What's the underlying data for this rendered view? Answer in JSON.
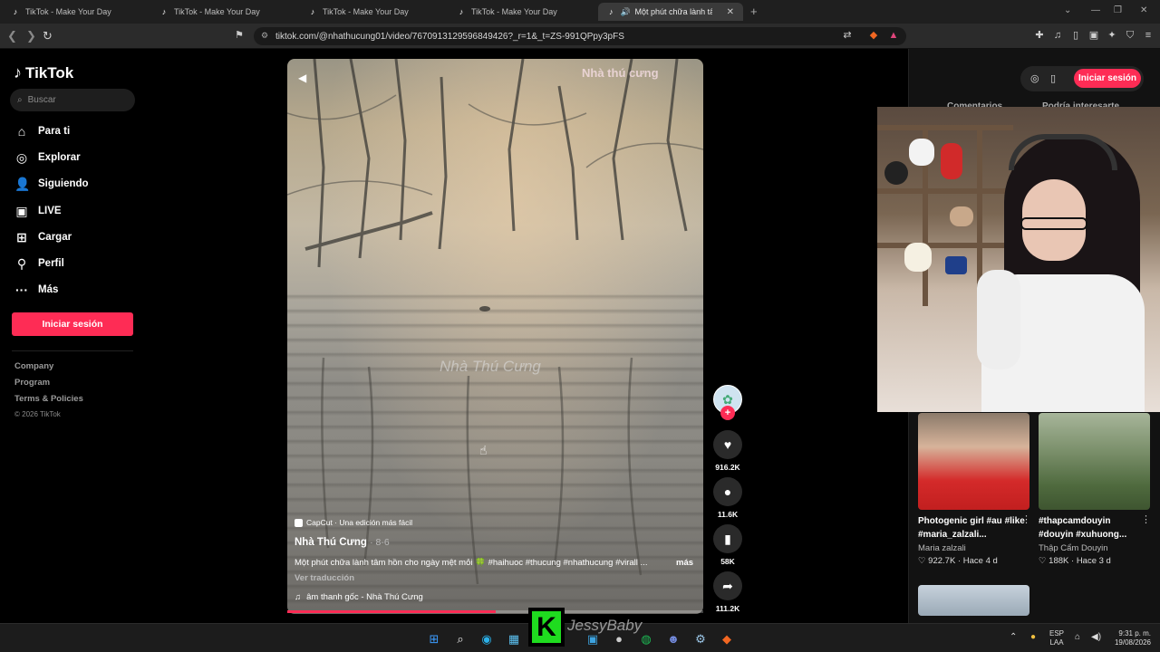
{
  "browser": {
    "tabs": [
      {
        "label": "TikTok - Make Your Day",
        "active": false
      },
      {
        "label": "TikTok - Make Your Day",
        "active": false
      },
      {
        "label": "TikTok - Make Your Day",
        "active": false
      },
      {
        "label": "TikTok - Make Your Day",
        "active": false
      },
      {
        "label": "Một phút chữa lành tâm hồn",
        "active": true
      }
    ],
    "url": "tiktok.com/@nhathucung01/video/7670913129596849426?_r=1&_t=ZS-991QPpy3pFS"
  },
  "sidebar": {
    "brand": "TikTok",
    "search_placeholder": "Buscar",
    "nav": [
      {
        "label": "Para ti",
        "icon": "home-icon"
      },
      {
        "label": "Explorar",
        "icon": "compass-icon"
      },
      {
        "label": "Siguiendo",
        "icon": "following-icon"
      },
      {
        "label": "LIVE",
        "icon": "live-icon"
      },
      {
        "label": "Cargar",
        "icon": "upload-icon"
      },
      {
        "label": "Perfil",
        "icon": "profile-icon"
      },
      {
        "label": "Más",
        "icon": "more-icon"
      }
    ],
    "login_label": "Iniciar sesión",
    "footer": [
      "Company",
      "Program",
      "Terms & Policies"
    ],
    "copyright": "© 2026 TikTok"
  },
  "video": {
    "watermark_top": "Nhà thú cưng",
    "watermark_mid": "Nhà Thú Cưng",
    "capcut": "CapCut · Una edición más fácil",
    "author": "Nhà Thú Cưng",
    "date": "· 8-6",
    "description": "Một phút chữa lành tâm hồn cho ngày mệt mỏi 🍀 #haihuoc #thucung #nhathucung #virall ...",
    "more": "más",
    "translate": "Ver traducción",
    "sound": "âm thanh gốc - Nhà Thú Cưng",
    "progress": 0.5
  },
  "actions": {
    "likes": "916.2K",
    "comments": "11.6K",
    "saves": "58K",
    "shares": "111.2K"
  },
  "right_panel": {
    "login_label": "Iniciar sesión",
    "tabs": [
      "Comentarios",
      "Podría interesarte"
    ],
    "cards": [
      {
        "title": "Photogenic girl #au #like #maria_zalzali...",
        "author": "Maria zalzali",
        "likes": "922.7K",
        "age": "Hace 4 d"
      },
      {
        "title": "#thapcamdouyin #douyin #xuhuong...",
        "author": "Thập Cẩm Douyin",
        "likes": "188K",
        "age": "Hace 3 d"
      }
    ]
  },
  "overlay": {
    "streamer_letter": "K",
    "streamer_name": "JessyBaby"
  },
  "taskbar": {
    "lang": "ESP",
    "lang2": "LAA",
    "time": "9:31 p. m.",
    "date": "19/08/2026"
  }
}
